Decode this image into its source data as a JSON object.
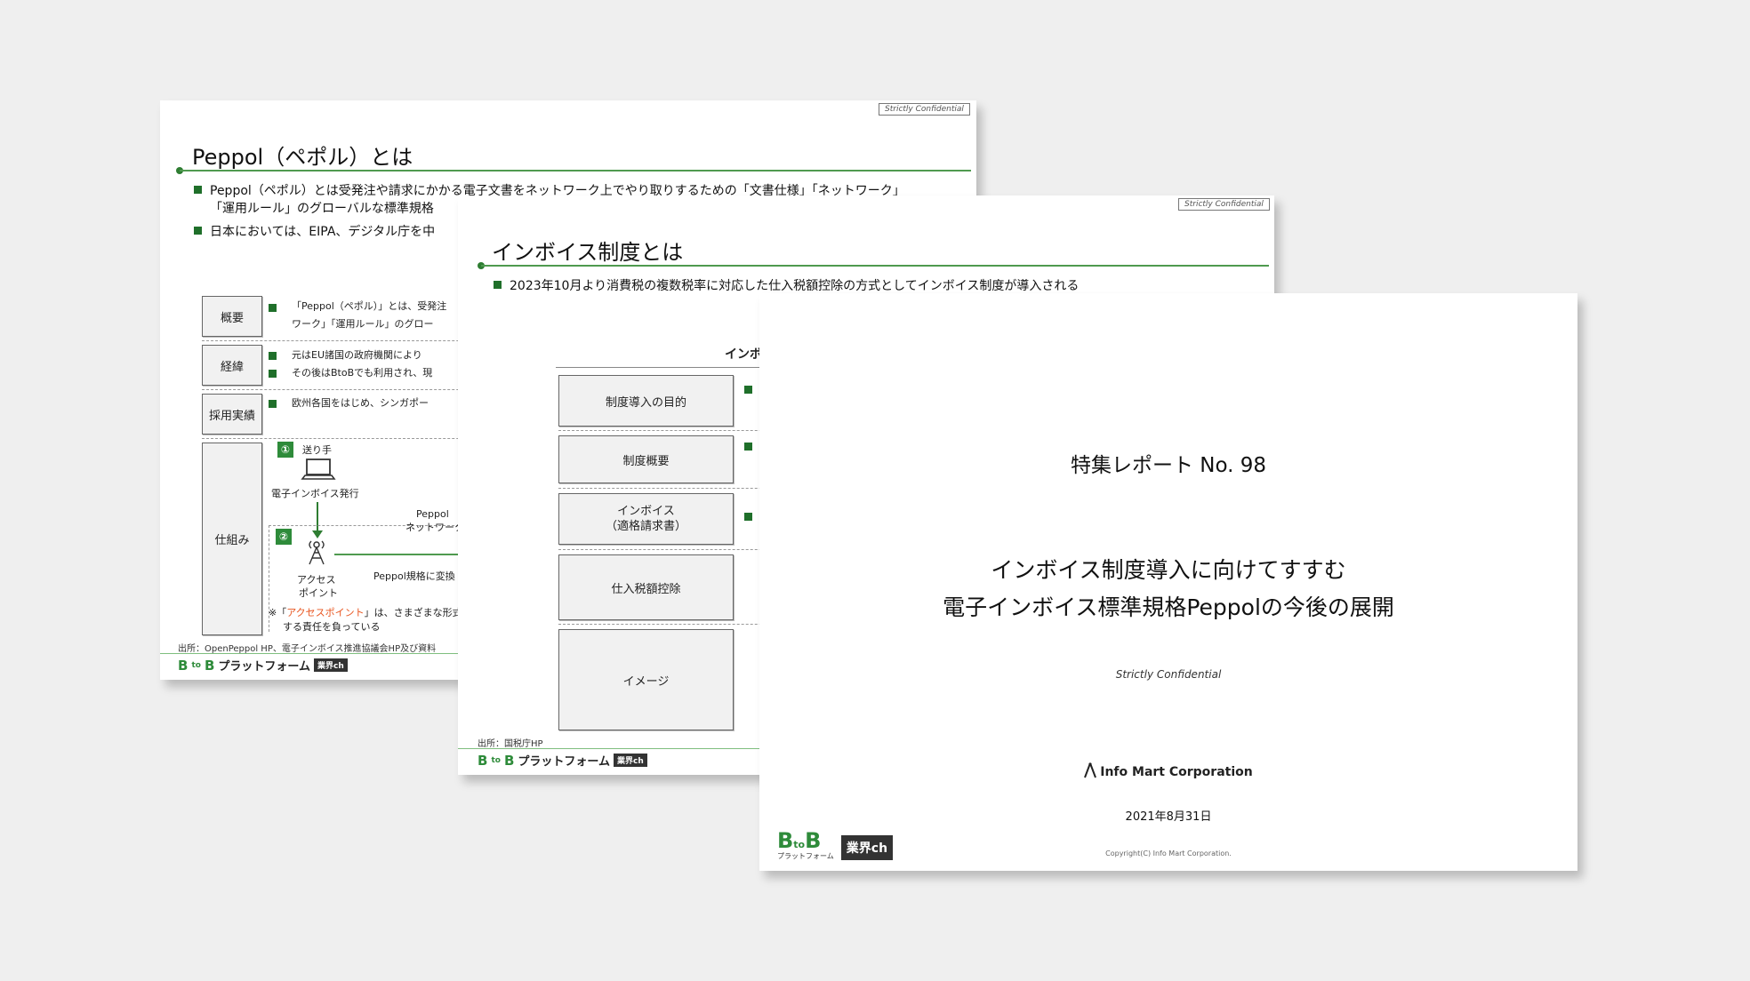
{
  "slides": {
    "peppol": {
      "confidential": "Strictly Confidential",
      "title": "Peppol（ペポル）とは",
      "bullets": [
        "Peppol（ペポル）とは受発注や請求にかかる電子文書をネットワーク上でやり取りするための「文書仕様」「ネットワーク」",
        "「運用ルール」のグローバルな標準規格",
        "日本においては、EIPA、デジタル庁を中"
      ],
      "rows": [
        {
          "label": "概要",
          "lines": [
            "「Peppol（ペポル）」とは、受発注",
            "ワーク」「運用ルール」のグロー"
          ]
        },
        {
          "label": "経緯",
          "lines": [
            "元はEU諸国の政府機関により",
            "その後はBtoBでも利用され、現"
          ]
        },
        {
          "label": "採用実績",
          "lines": [
            "欧州各国をはじめ、シンガポー"
          ]
        },
        {
          "label": "仕組み",
          "lines": []
        }
      ],
      "diagram": {
        "step1": "①",
        "sender": "送り手",
        "issue": "電子インボイス発行",
        "network": [
          "Peppol",
          "ネットワーク"
        ],
        "step2": "②",
        "access_point": [
          "アクセス",
          "ポイント"
        ],
        "convert": "Peppol規格に変換",
        "note_prefix": "※「",
        "note_highlight": "アクセスポイント",
        "note_rest": "」は、さまざまな形式",
        "note_line2": "する責任を負っている"
      },
      "source": "出所：OpenPeppol HP、電子インボイス推進協議会HP及び資料",
      "brand": {
        "b1": "B",
        "to": "to",
        "b2": "B",
        "text": "プラットフォーム",
        "tag": "業界ch"
      }
    },
    "invoice": {
      "confidential": "Strictly Confidential",
      "title": "インボイス制度とは",
      "bullet": "2023年10月より消費税の複数税率に対応した仕入税額控除の方式としてインボイス制度が導入される",
      "section_label": "インボ",
      "boxes": [
        "制度導入の目的",
        "制度概要",
        "インボイス\n（適格請求書）",
        "仕入税額控除",
        "イメージ"
      ],
      "source": "出所：国税庁HP",
      "brand": {
        "b1": "B",
        "to": "to",
        "b2": "B",
        "text": "プラットフォーム",
        "tag": "業界ch"
      }
    },
    "cover": {
      "report_no": "特集レポート No. 98",
      "title_line1": "インボイス制度導入に向けてすすむ",
      "title_line2": "電子インボイス標準規格Peppolの今後の展開",
      "confidential": "Strictly Confidential",
      "company": "Info Mart Corporation",
      "date": "2021年8月31日",
      "copyright": "Copyright(C) Info Mart Corporation.",
      "brand": {
        "b1": "B",
        "to": "to",
        "b2": "B",
        "sub": "プラットフォーム",
        "tag": "業界ch"
      }
    }
  },
  "colors": {
    "accent_green": "#2e8b3a",
    "highlight_orange": "#e8541e",
    "background": "#efefef"
  }
}
